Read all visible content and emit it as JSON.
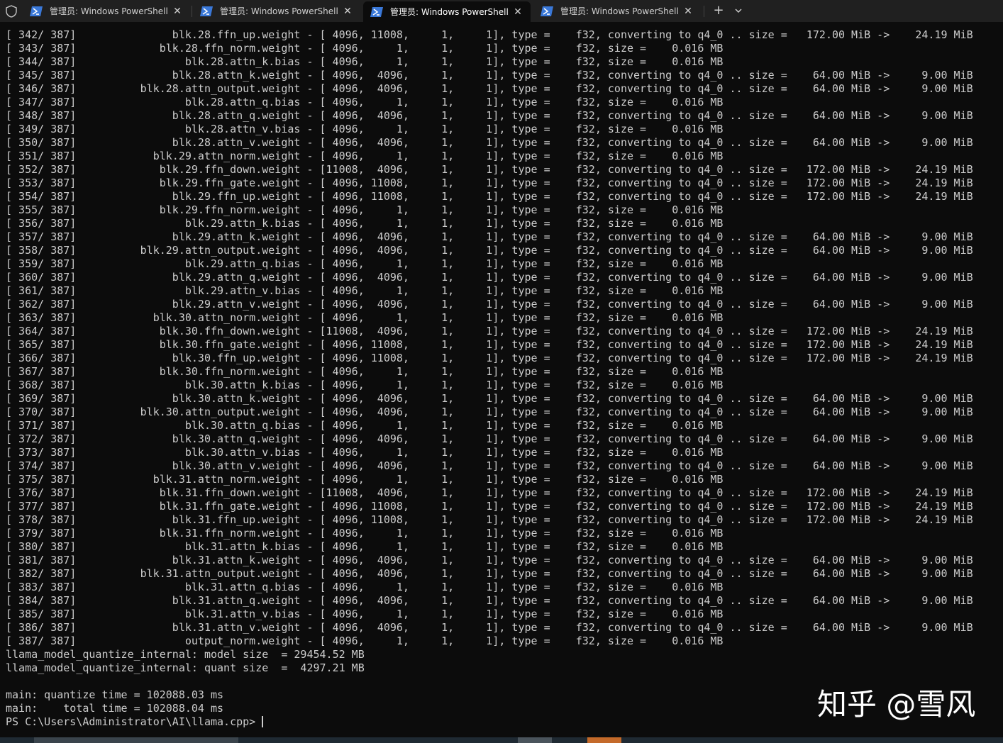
{
  "tabs": [
    {
      "title": "管理员: Windows PowerShell",
      "active": false
    },
    {
      "title": "管理员: Windows PowerShell",
      "active": false
    },
    {
      "title": "管理员: Windows PowerShell",
      "active": true
    },
    {
      "title": "管理员: Windows PowerShell",
      "active": false
    }
  ],
  "tab_close_glyph": "✕",
  "new_tab_glyph": "+",
  "colors": {
    "accent": "#3a78d8",
    "background": "#0c0c0c",
    "text": "#cccccc"
  },
  "terminal_lines": [
    "[ 342/ 387]               blk.28.ffn_up.weight - [ 4096, 11008,     1,     1], type =    f32, converting to q4_0 .. size =   172.00 MiB ->    24.19 MiB",
    "[ 343/ 387]             blk.28.ffn_norm.weight - [ 4096,     1,     1,     1], type =    f32, size =    0.016 MB",
    "[ 344/ 387]                 blk.28.attn_k.bias - [ 4096,     1,     1,     1], type =    f32, size =    0.016 MB",
    "[ 345/ 387]               blk.28.attn_k.weight - [ 4096,  4096,     1,     1], type =    f32, converting to q4_0 .. size =    64.00 MiB ->     9.00 MiB",
    "[ 346/ 387]          blk.28.attn_output.weight - [ 4096,  4096,     1,     1], type =    f32, converting to q4_0 .. size =    64.00 MiB ->     9.00 MiB",
    "[ 347/ 387]                 blk.28.attn_q.bias - [ 4096,     1,     1,     1], type =    f32, size =    0.016 MB",
    "[ 348/ 387]               blk.28.attn_q.weight - [ 4096,  4096,     1,     1], type =    f32, converting to q4_0 .. size =    64.00 MiB ->     9.00 MiB",
    "[ 349/ 387]                 blk.28.attn_v.bias - [ 4096,     1,     1,     1], type =    f32, size =    0.016 MB",
    "[ 350/ 387]               blk.28.attn_v.weight - [ 4096,  4096,     1,     1], type =    f32, converting to q4_0 .. size =    64.00 MiB ->     9.00 MiB",
    "[ 351/ 387]            blk.29.attn_norm.weight - [ 4096,     1,     1,     1], type =    f32, size =    0.016 MB",
    "[ 352/ 387]             blk.29.ffn_down.weight - [11008,  4096,     1,     1], type =    f32, converting to q4_0 .. size =   172.00 MiB ->    24.19 MiB",
    "[ 353/ 387]             blk.29.ffn_gate.weight - [ 4096, 11008,     1,     1], type =    f32, converting to q4_0 .. size =   172.00 MiB ->    24.19 MiB",
    "[ 354/ 387]               blk.29.ffn_up.weight - [ 4096, 11008,     1,     1], type =    f32, converting to q4_0 .. size =   172.00 MiB ->    24.19 MiB",
    "[ 355/ 387]             blk.29.ffn_norm.weight - [ 4096,     1,     1,     1], type =    f32, size =    0.016 MB",
    "[ 356/ 387]                 blk.29.attn_k.bias - [ 4096,     1,     1,     1], type =    f32, size =    0.016 MB",
    "[ 357/ 387]               blk.29.attn_k.weight - [ 4096,  4096,     1,     1], type =    f32, converting to q4_0 .. size =    64.00 MiB ->     9.00 MiB",
    "[ 358/ 387]          blk.29.attn_output.weight - [ 4096,  4096,     1,     1], type =    f32, converting to q4_0 .. size =    64.00 MiB ->     9.00 MiB",
    "[ 359/ 387]                 blk.29.attn_q.bias - [ 4096,     1,     1,     1], type =    f32, size =    0.016 MB",
    "[ 360/ 387]               blk.29.attn_q.weight - [ 4096,  4096,     1,     1], type =    f32, converting to q4_0 .. size =    64.00 MiB ->     9.00 MiB",
    "[ 361/ 387]                 blk.29.attn_v.bias - [ 4096,     1,     1,     1], type =    f32, size =    0.016 MB",
    "[ 362/ 387]               blk.29.attn_v.weight - [ 4096,  4096,     1,     1], type =    f32, converting to q4_0 .. size =    64.00 MiB ->     9.00 MiB",
    "[ 363/ 387]            blk.30.attn_norm.weight - [ 4096,     1,     1,     1], type =    f32, size =    0.016 MB",
    "[ 364/ 387]             blk.30.ffn_down.weight - [11008,  4096,     1,     1], type =    f32, converting to q4_0 .. size =   172.00 MiB ->    24.19 MiB",
    "[ 365/ 387]             blk.30.ffn_gate.weight - [ 4096, 11008,     1,     1], type =    f32, converting to q4_0 .. size =   172.00 MiB ->    24.19 MiB",
    "[ 366/ 387]               blk.30.ffn_up.weight - [ 4096, 11008,     1,     1], type =    f32, converting to q4_0 .. size =   172.00 MiB ->    24.19 MiB",
    "[ 367/ 387]             blk.30.ffn_norm.weight - [ 4096,     1,     1,     1], type =    f32, size =    0.016 MB",
    "[ 368/ 387]                 blk.30.attn_k.bias - [ 4096,     1,     1,     1], type =    f32, size =    0.016 MB",
    "[ 369/ 387]               blk.30.attn_k.weight - [ 4096,  4096,     1,     1], type =    f32, converting to q4_0 .. size =    64.00 MiB ->     9.00 MiB",
    "[ 370/ 387]          blk.30.attn_output.weight - [ 4096,  4096,     1,     1], type =    f32, converting to q4_0 .. size =    64.00 MiB ->     9.00 MiB",
    "[ 371/ 387]                 blk.30.attn_q.bias - [ 4096,     1,     1,     1], type =    f32, size =    0.016 MB",
    "[ 372/ 387]               blk.30.attn_q.weight - [ 4096,  4096,     1,     1], type =    f32, converting to q4_0 .. size =    64.00 MiB ->     9.00 MiB",
    "[ 373/ 387]                 blk.30.attn_v.bias - [ 4096,     1,     1,     1], type =    f32, size =    0.016 MB",
    "[ 374/ 387]               blk.30.attn_v.weight - [ 4096,  4096,     1,     1], type =    f32, converting to q4_0 .. size =    64.00 MiB ->     9.00 MiB",
    "[ 375/ 387]            blk.31.attn_norm.weight - [ 4096,     1,     1,     1], type =    f32, size =    0.016 MB",
    "[ 376/ 387]             blk.31.ffn_down.weight - [11008,  4096,     1,     1], type =    f32, converting to q4_0 .. size =   172.00 MiB ->    24.19 MiB",
    "[ 377/ 387]             blk.31.ffn_gate.weight - [ 4096, 11008,     1,     1], type =    f32, converting to q4_0 .. size =   172.00 MiB ->    24.19 MiB",
    "[ 378/ 387]               blk.31.ffn_up.weight - [ 4096, 11008,     1,     1], type =    f32, converting to q4_0 .. size =   172.00 MiB ->    24.19 MiB",
    "[ 379/ 387]             blk.31.ffn_norm.weight - [ 4096,     1,     1,     1], type =    f32, size =    0.016 MB",
    "[ 380/ 387]                 blk.31.attn_k.bias - [ 4096,     1,     1,     1], type =    f32, size =    0.016 MB",
    "[ 381/ 387]               blk.31.attn_k.weight - [ 4096,  4096,     1,     1], type =    f32, converting to q4_0 .. size =    64.00 MiB ->     9.00 MiB",
    "[ 382/ 387]          blk.31.attn_output.weight - [ 4096,  4096,     1,     1], type =    f32, converting to q4_0 .. size =    64.00 MiB ->     9.00 MiB",
    "[ 383/ 387]                 blk.31.attn_q.bias - [ 4096,     1,     1,     1], type =    f32, size =    0.016 MB",
    "[ 384/ 387]               blk.31.attn_q.weight - [ 4096,  4096,     1,     1], type =    f32, converting to q4_0 .. size =    64.00 MiB ->     9.00 MiB",
    "[ 385/ 387]                 blk.31.attn_v.bias - [ 4096,     1,     1,     1], type =    f32, size =    0.016 MB",
    "[ 386/ 387]               blk.31.attn_v.weight - [ 4096,  4096,     1,     1], type =    f32, converting to q4_0 .. size =    64.00 MiB ->     9.00 MiB",
    "[ 387/ 387]                 output_norm.weight - [ 4096,     1,     1,     1], type =    f32, size =    0.016 MB",
    "llama_model_quantize_internal: model size  = 29454.52 MB",
    "llama_model_quantize_internal: quant size  =  4297.21 MB",
    "",
    "main: quantize time = 102088.03 ms",
    "main:    total time = 102088.04 ms"
  ],
  "prompt": "PS C:\\Users\\Administrator\\AI\\llama.cpp> ",
  "watermark": "知乎 @雪风"
}
